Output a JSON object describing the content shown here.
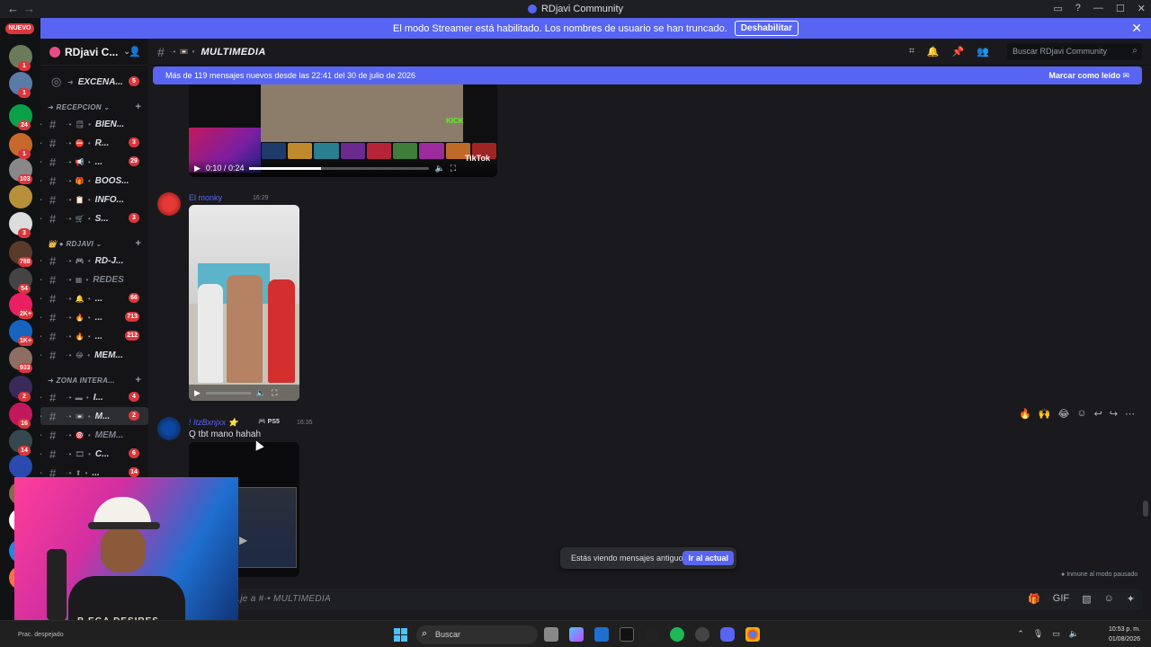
{
  "window": {
    "title": "RDjavi Community"
  },
  "banner": {
    "text": "El modo Streamer está habilitado. Los nombres de usuario se han truncado.",
    "button": "Deshabilitar"
  },
  "rail": {
    "nuevo": "NUEVO",
    "badges": [
      "1",
      "1",
      "24",
      "1",
      "103",
      "3",
      "788",
      "54",
      "2K+",
      "1K+",
      "933",
      "2",
      "16",
      "14"
    ]
  },
  "sidebar": {
    "server_name": "RDjavi C...",
    "top_channel": "EXCENA...",
    "top_channel_badge": "5",
    "categories": [
      "RECEPCION",
      "RDJAVI",
      "ZONA INTERA..."
    ],
    "channels": [
      {
        "name": "BIEN...",
        "badge": ""
      },
      {
        "name": "R...",
        "badge": "3"
      },
      {
        "name": "...",
        "badge": "29"
      },
      {
        "name": "BOOS...",
        "badge": ""
      },
      {
        "name": "INFO...",
        "badge": ""
      },
      {
        "name": "S...",
        "badge": "3"
      },
      {
        "name": "RD-J...",
        "badge": ""
      },
      {
        "name": "REDES",
        "badge": ""
      },
      {
        "name": "...",
        "badge": "66"
      },
      {
        "name": "...",
        "badge": "713"
      },
      {
        "name": "...",
        "badge": "212"
      },
      {
        "name": "MEM...",
        "badge": ""
      },
      {
        "name": "I...",
        "badge": "4"
      },
      {
        "name": "M...",
        "badge": "2"
      },
      {
        "name": "MEM...",
        "badge": ""
      },
      {
        "name": "C...",
        "badge": "6"
      },
      {
        "name": "...",
        "badge": "14"
      }
    ]
  },
  "header": {
    "channel_title": "MULTIMEDIA",
    "search_placeholder": "Buscar RDjavi Community"
  },
  "new_messages": {
    "text": "Más de 119 mensajes nuevos desde las 22:41 del 30 de julio de 2026",
    "mark_read": "Marcar como leído"
  },
  "messages": [
    {
      "video_time": "0:10 / 0:24",
      "kick": "KICK",
      "tiktok": "TikTok"
    },
    {
      "author": "El monky",
      "time": "16:29"
    },
    {
      "author": "ItzBxnjxx",
      "tag": "PS5",
      "time": "16:35",
      "text": "Q tbt mano hahah"
    }
  ],
  "old_messages": {
    "text": "Estás viendo mensajes antiguos",
    "button": "Ir al actual"
  },
  "immune_text": "Inmune al modo pausado",
  "composer": {
    "placeholder": "...je a #·• MULTIMEDIA"
  },
  "webcam": {
    "jersey_text": "B   EGA  DESIRES"
  },
  "taskbar": {
    "weather": "Prac. despejado",
    "search": "Buscar",
    "time": "10:53 p. m.",
    "date": "01/08/2026"
  },
  "colors": {
    "blurple": "#5865f2",
    "badge_red": "#da373c",
    "bg": "#1a1a1e"
  }
}
